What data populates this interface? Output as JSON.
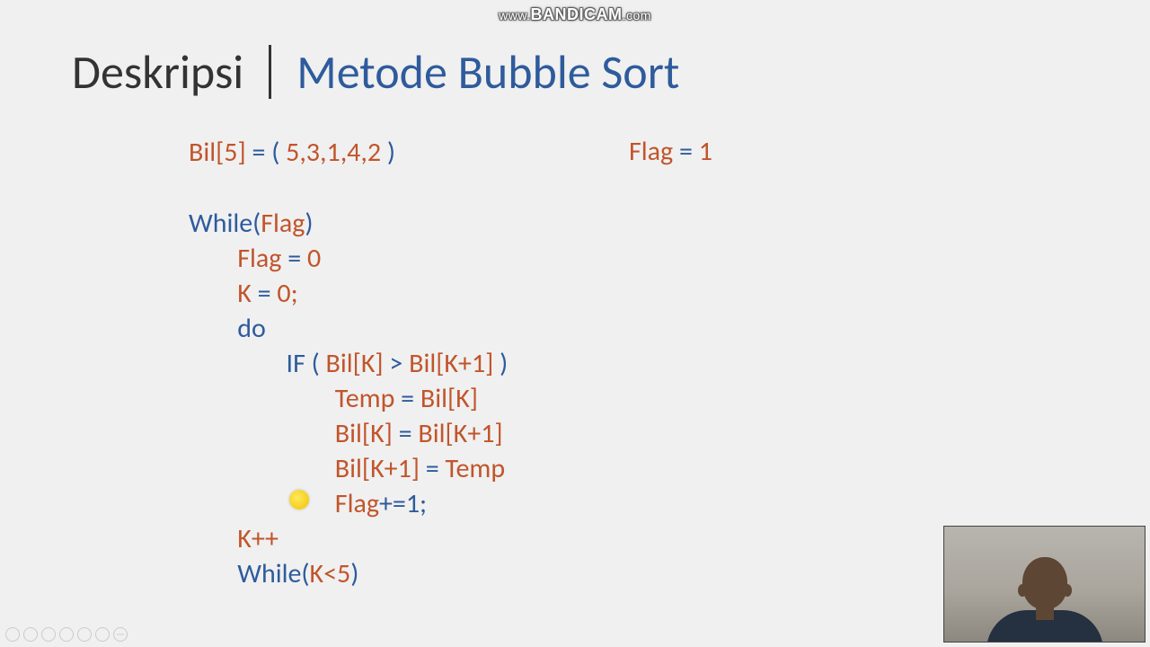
{
  "watermark": {
    "prefix": "www.",
    "brand": "BANDICAM",
    "suffix": ".com"
  },
  "title": {
    "main": "Deskripsi",
    "sub": "Metode Bubble Sort"
  },
  "decl": {
    "bil_label": "Bil[5]",
    "eq": " = ",
    "paren_open": "( ",
    "values": "5,3,1,4,2",
    "paren_close": " )",
    "flag_label": "Flag",
    "flag_eq": " = ",
    "flag_val": "1"
  },
  "code": {
    "l1a": "While(",
    "l1b": "Flag",
    "l1c": ")",
    "l2a": "Flag",
    "l2b": " = ",
    "l2c": "0",
    "l3a": "K",
    "l3b": " = ",
    "l3c": "0;",
    "l4": "do",
    "l5a": "IF ( ",
    "l5b": "Bil[K]",
    "l5c": " > ",
    "l5d": "Bil[K+1]",
    "l5e": " )",
    "l6a": "Temp",
    "l6b": " = ",
    "l6c": "Bil[K]",
    "l7a": "Bil[K]",
    "l7b": " = ",
    "l7c": "Bil[K+1]",
    "l8a": "Bil[K+1]",
    "l8b": " = ",
    "l8c": "Temp",
    "l9a": "Flag",
    "l9b": "+=1;",
    "l10": "K++",
    "l11a": "While(",
    "l11b": "K<5",
    "l11c": ")"
  }
}
